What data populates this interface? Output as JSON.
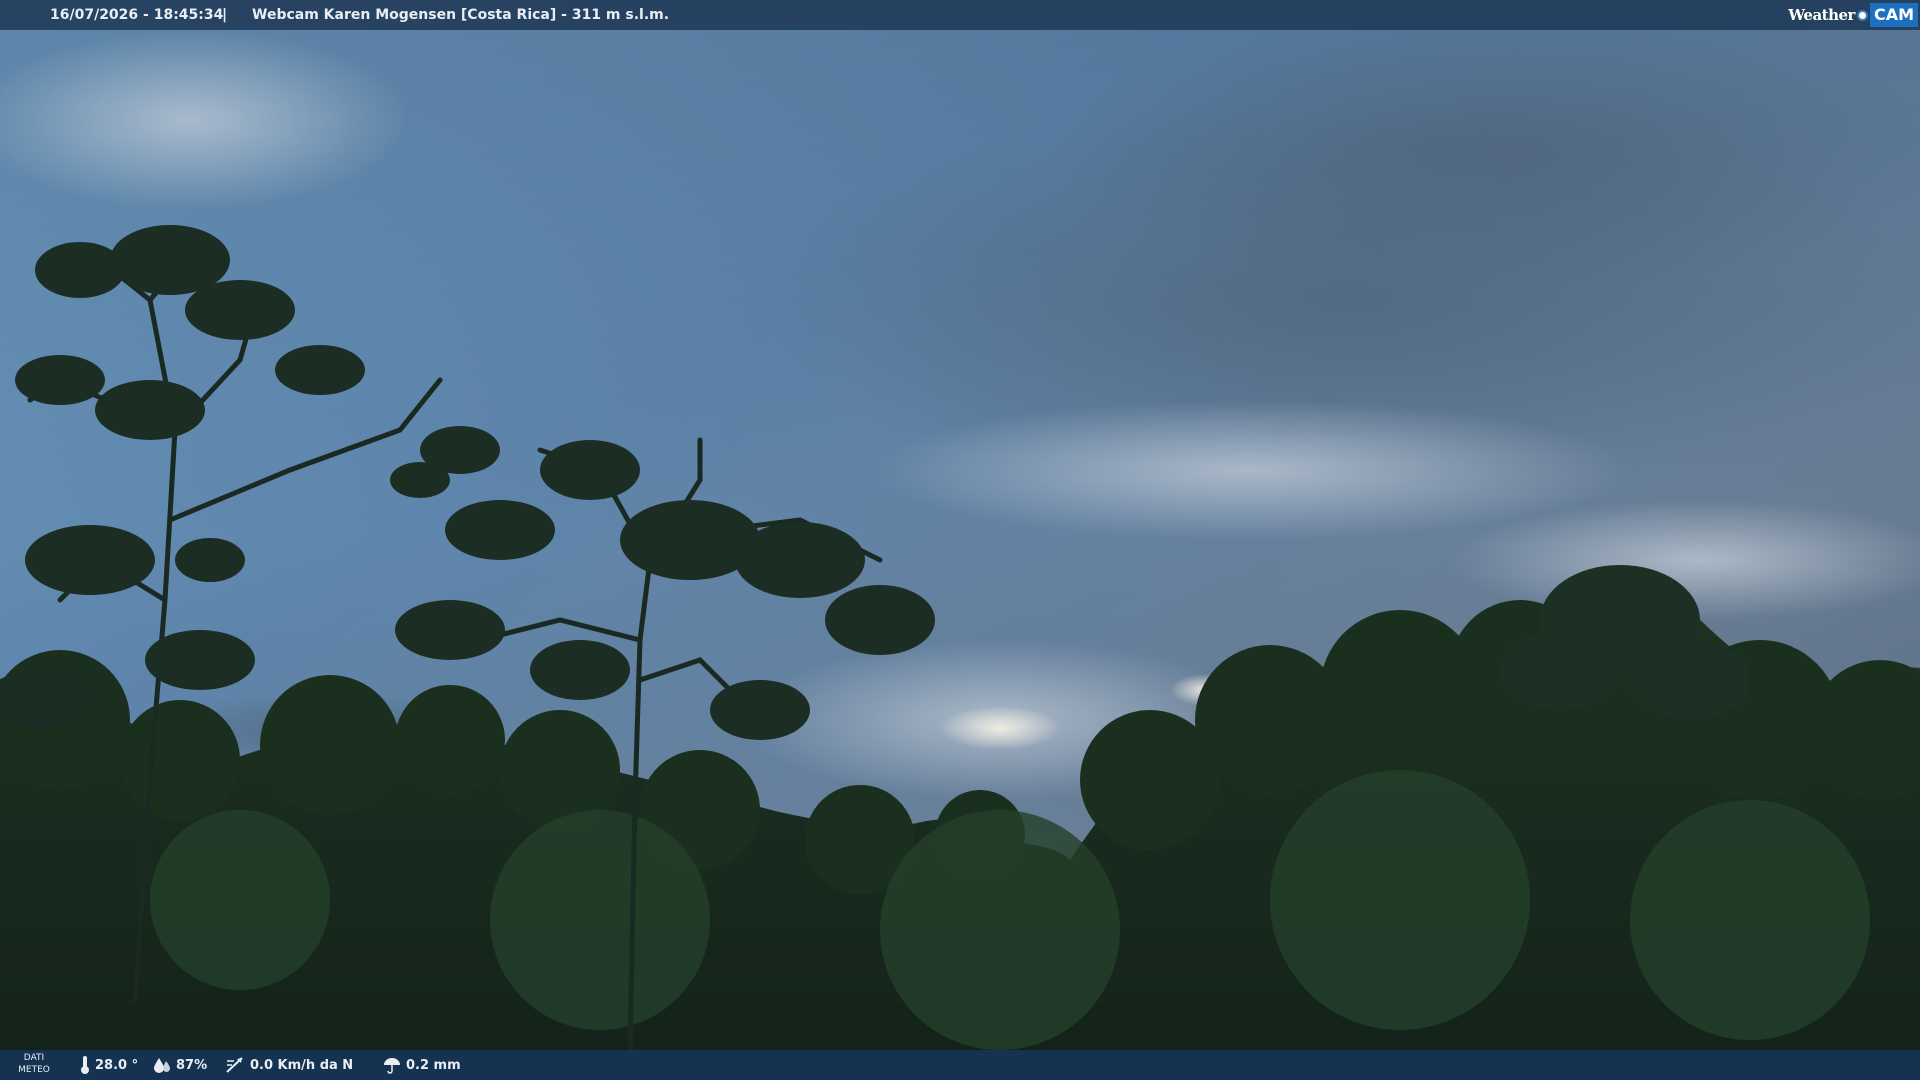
{
  "header": {
    "timestamp": "16/07/2026 - 18:45:34",
    "separator": "|",
    "title": "Webcam Karen Mogensen [Costa Rica]  - 311 m s.l.m."
  },
  "brand": {
    "weather_text": "Weather",
    "cam_text": "CAM"
  },
  "weather_bar": {
    "label_line1": "DATI",
    "label_line2": "METEO",
    "temperature": "28.0 °",
    "humidity": "87%",
    "wind": "0.0 Km/h da N",
    "rain": "0.2 mm"
  },
  "colors": {
    "bar_background": "#203a58",
    "brand_blue": "#1d6fc0",
    "bar_text": "#e9eef4"
  }
}
